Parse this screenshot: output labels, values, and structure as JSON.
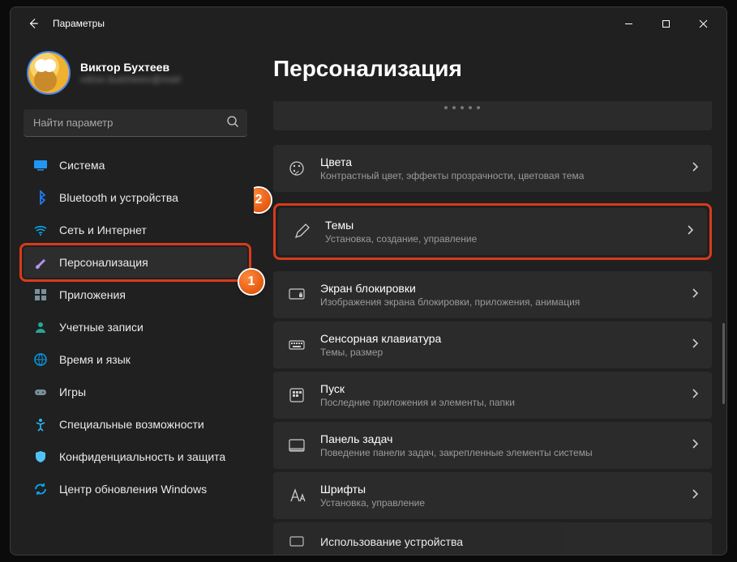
{
  "window": {
    "title": "Параметры"
  },
  "profile": {
    "name": "Виктор Бухтеев",
    "email": "viktor.bukhteev@mail"
  },
  "search": {
    "placeholder": "Найти параметр"
  },
  "nav": [
    {
      "id": "system",
      "label": "Система"
    },
    {
      "id": "bluetooth",
      "label": "Bluetooth и устройства"
    },
    {
      "id": "network",
      "label": "Сеть и Интернет"
    },
    {
      "id": "personalization",
      "label": "Персонализация"
    },
    {
      "id": "apps",
      "label": "Приложения"
    },
    {
      "id": "accounts",
      "label": "Учетные записи"
    },
    {
      "id": "time",
      "label": "Время и язык"
    },
    {
      "id": "gaming",
      "label": "Игры"
    },
    {
      "id": "accessibility",
      "label": "Специальные возможности"
    },
    {
      "id": "privacy",
      "label": "Конфиденциальность и защита"
    },
    {
      "id": "update",
      "label": "Центр обновления Windows"
    }
  ],
  "page": {
    "title": "Персонализация"
  },
  "settings": [
    {
      "id": "colors",
      "title": "Цвета",
      "sub": "Контрастный цвет, эффекты прозрачности, цветовая тема"
    },
    {
      "id": "themes",
      "title": "Темы",
      "sub": "Установка, создание, управление"
    },
    {
      "id": "lock",
      "title": "Экран блокировки",
      "sub": "Изображения экрана блокировки, приложения, анимация"
    },
    {
      "id": "touchkb",
      "title": "Сенсорная клавиатура",
      "sub": "Темы, размер"
    },
    {
      "id": "start",
      "title": "Пуск",
      "sub": "Последние приложения и элементы, папки"
    },
    {
      "id": "taskbar",
      "title": "Панель задач",
      "sub": "Поведение панели задач, закрепленные элементы системы"
    },
    {
      "id": "fonts",
      "title": "Шрифты",
      "sub": "Установка, управление"
    },
    {
      "id": "devusage",
      "title": "Использование устройства",
      "sub": ""
    }
  ],
  "badges": {
    "one": "1",
    "two": "2"
  },
  "icons": {
    "system": "#2196f3",
    "bluetooth": "#1d82ff",
    "network": "#00b0ff",
    "personalization": "#7e57c2",
    "apps": "#546e7a",
    "accounts": "#26a69a",
    "time": "#039be5",
    "gaming": "#78909c",
    "accessibility": "#29b6f6",
    "privacy": "#4fc3f7",
    "update": "#03a9f4"
  }
}
